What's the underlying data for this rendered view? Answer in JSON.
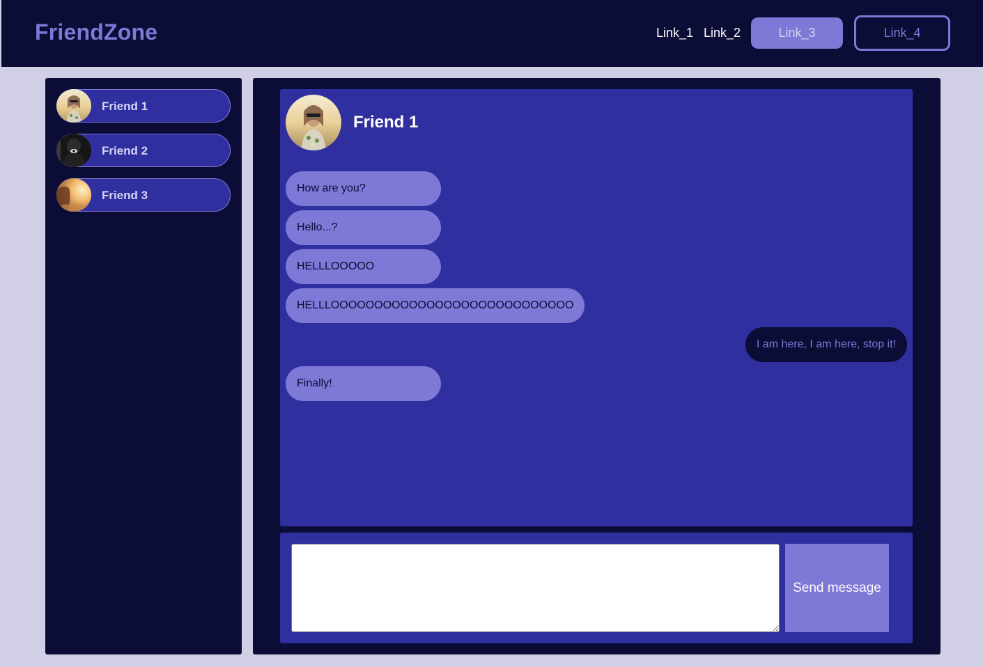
{
  "app": {
    "logo": "FriendZone"
  },
  "nav": {
    "link_1": "Link_1",
    "link_2": "Link_2",
    "link_3": "Link_3",
    "link_4": "Link_4"
  },
  "sidebar": {
    "friends": [
      {
        "name": "Friend 1",
        "avatar": "portrait-woman-sunglasses"
      },
      {
        "name": "Friend 2",
        "avatar": "dark-figure"
      },
      {
        "name": "Friend 3",
        "avatar": "sunset-silhouette"
      }
    ]
  },
  "chat": {
    "contact_name": "Friend 1",
    "messages": [
      {
        "direction": "incoming",
        "text": "How are you?"
      },
      {
        "direction": "incoming",
        "text": "Hello...?"
      },
      {
        "direction": "incoming",
        "text": "HELLLOOOOO"
      },
      {
        "direction": "incoming",
        "text": "HELLLOOOOOOOOOOOOOOOOOOOOOOOOOOOO"
      },
      {
        "direction": "outgoing",
        "text": "I am here, I am here, stop it!"
      },
      {
        "direction": "incoming",
        "text": "Finally!"
      }
    ]
  },
  "composer": {
    "input_value": "",
    "send_label": "Send message"
  },
  "colors": {
    "dark_navy": "#0c0d36",
    "indigo": "#2f2fa0",
    "lavender": "#7e78d6",
    "background": "#d0cfe6"
  }
}
